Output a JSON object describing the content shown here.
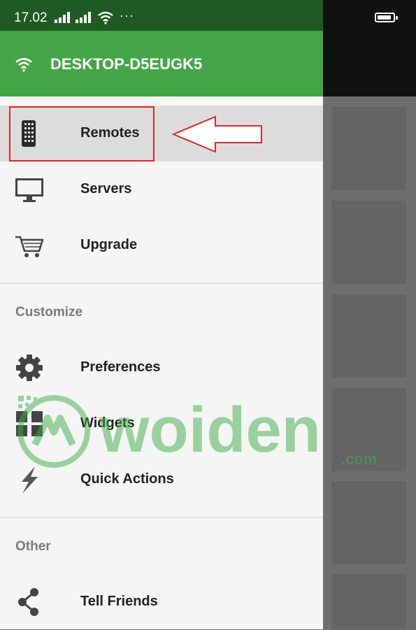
{
  "status_bar": {
    "time": "17.02",
    "more": "···"
  },
  "drawer": {
    "header": {
      "title": "DESKTOP-D5EUGK5",
      "icon": "wifi-icon"
    },
    "items": [
      {
        "label": "Remotes",
        "icon": "remote-icon",
        "selected": true
      },
      {
        "label": "Servers",
        "icon": "monitor-icon"
      },
      {
        "label": "Upgrade",
        "icon": "cart-icon"
      }
    ],
    "sections": [
      {
        "title": "Customize",
        "items": [
          {
            "label": "Preferences",
            "icon": "gear-icon"
          },
          {
            "label": "Widgets",
            "icon": "widgets-icon"
          },
          {
            "label": "Quick Actions",
            "icon": "bolt-icon"
          }
        ]
      },
      {
        "title": "Other",
        "items": [
          {
            "label": "Tell Friends",
            "icon": "share-icon"
          }
        ]
      }
    ]
  },
  "annotation": {
    "color": "#e0262a"
  },
  "watermark": {
    "brand": "woiden",
    "suffix": ".com",
    "color": "#3fae4a"
  },
  "colors": {
    "header_green": "#44a547",
    "status_green": "#1e5a22",
    "selected_bg": "#dcdcdc"
  }
}
